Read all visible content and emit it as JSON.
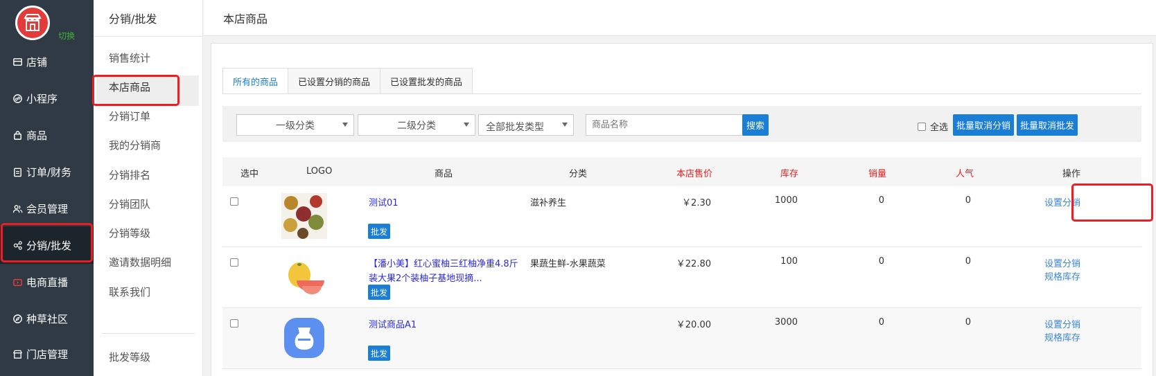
{
  "sidebar": {
    "switch_label": "切换",
    "items": [
      {
        "label": "店铺",
        "icon": "store-icon"
      },
      {
        "label": "小程序",
        "icon": "miniapp-icon"
      },
      {
        "label": "商品",
        "icon": "bag-icon"
      },
      {
        "label": "订单/财务",
        "icon": "clipboard-icon"
      },
      {
        "label": "会员管理",
        "icon": "users-icon"
      },
      {
        "label": "分销/批发",
        "icon": "share-icon"
      },
      {
        "label": "电商直播",
        "icon": "live-icon"
      },
      {
        "label": "种草社区",
        "icon": "compass-icon"
      },
      {
        "label": "门店管理",
        "icon": "shop-icon"
      }
    ],
    "active_index": 5,
    "live_color": "#e33a3a"
  },
  "subnav": {
    "title": "分销/批发",
    "items": [
      "销售统计",
      "本店商品",
      "分销订单",
      "我的分销商",
      "分销排名",
      "分销团队",
      "分销等级",
      "邀请数据明细",
      "联系我们"
    ],
    "items2": [
      "批发等级"
    ],
    "active_index": 1
  },
  "header": {
    "title": "本店商品"
  },
  "tabs": [
    "所有的商品",
    "已设置分销的商品",
    "已设置批发的商品"
  ],
  "filters": {
    "category1": "一级分类",
    "category2": "二级分类",
    "wholesale_type": "全部批发类型",
    "name_placeholder": "商品名称",
    "search_label": "搜索",
    "select_all": "全选",
    "bulk_cancel_dist": "批量取消分销",
    "bulk_cancel_wholesale": "批量取消批发"
  },
  "table": {
    "columns": [
      "选中",
      "LOGO",
      "商品",
      "分类",
      "本店售价",
      "库存",
      "销量",
      "人气",
      "操作"
    ],
    "rows": [
      {
        "name": "测试01",
        "name2": "",
        "category": "滋补养生",
        "price": "￥2.30",
        "stock": "1000",
        "sales": "0",
        "popularity": "0",
        "tag": "批发",
        "ops": [
          "设置分销"
        ]
      },
      {
        "name": "【潘小美】红心蜜柚三红柚净重4.8斤",
        "name2": "装大果2个装柚子基地现摘...",
        "category": "果蔬生鲜-水果蔬菜",
        "price": "￥22.80",
        "stock": "100",
        "sales": "0",
        "popularity": "0",
        "tag": "批发",
        "ops": [
          "设置分销",
          "规格库存"
        ]
      },
      {
        "name": "测试商品A1",
        "name2": "",
        "category": "",
        "price": "￥20.00",
        "stock": "3000",
        "sales": "0",
        "popularity": "0",
        "tag": "批发",
        "ops": [
          "设置分销",
          "规格库存"
        ]
      }
    ]
  },
  "colors": {
    "accent": "#1a7ed6",
    "highlight": "#ee1d24",
    "sidebar": "#2f3a45"
  }
}
